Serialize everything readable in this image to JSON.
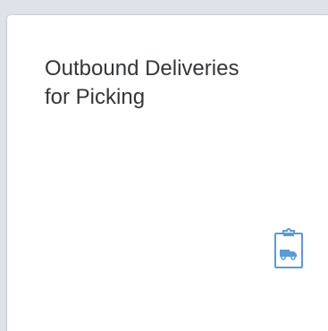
{
  "tile": {
    "title_line1": "Outbound Deliveries",
    "title_line2": "for Picking",
    "icon": "clipboard-truck-icon",
    "icon_color": "#5b9bd5"
  }
}
